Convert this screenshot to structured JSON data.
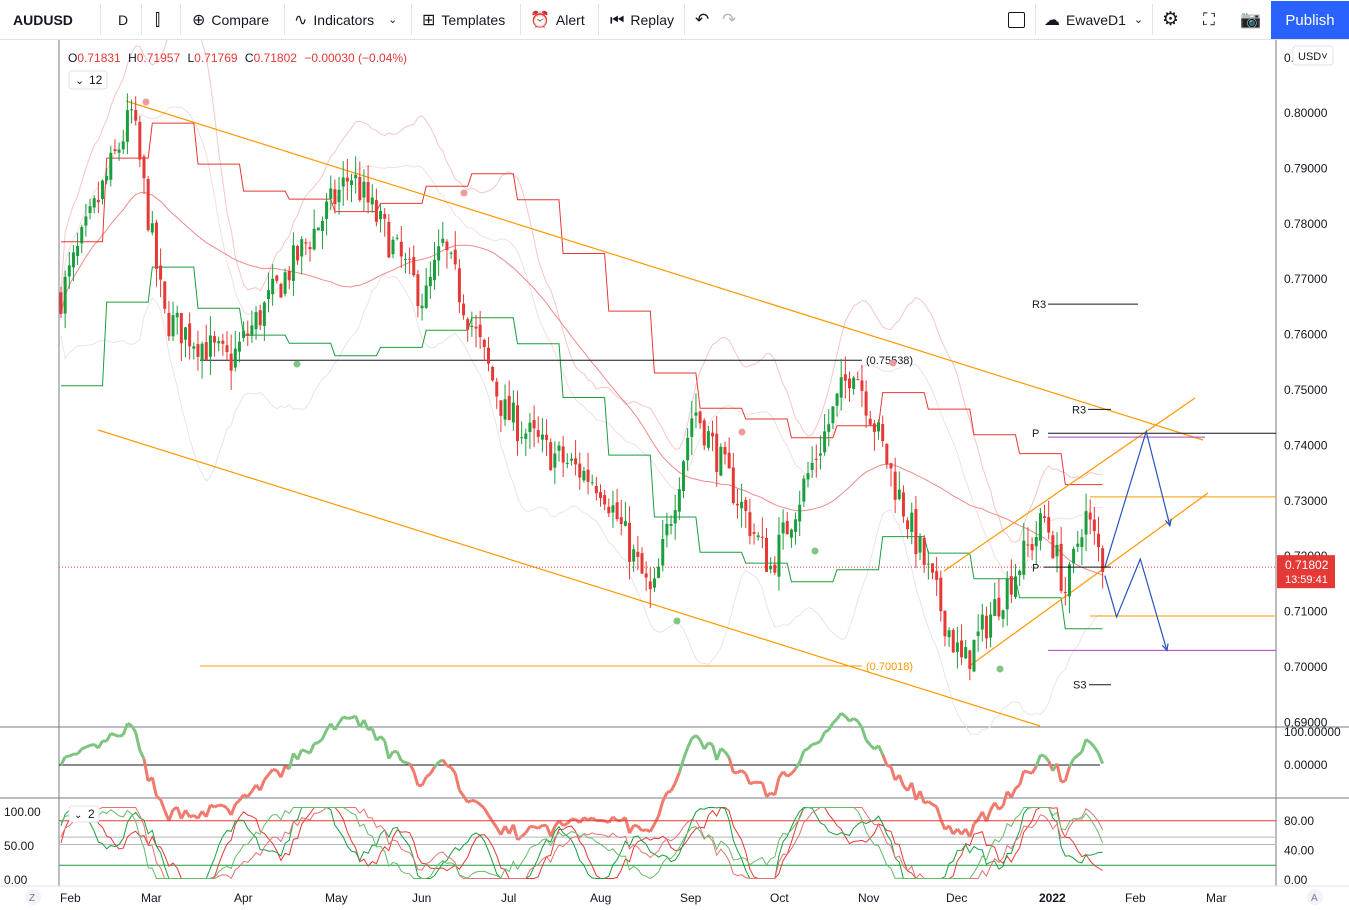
{
  "toolbar": {
    "symbol": "AUDUSD",
    "interval": "D",
    "compare": "Compare",
    "indicators": "Indicators",
    "templates": "Templates",
    "alert": "Alert",
    "replay": "Replay",
    "layout_name": "EwaveD1",
    "publish": "Publish"
  },
  "legend": {
    "ohlc": [
      {
        "k": "O",
        "v": "0.71831"
      },
      {
        "k": "H",
        "v": "0.71957"
      },
      {
        "k": "L",
        "v": "0.71769"
      },
      {
        "k": "C",
        "v": "0.71802"
      }
    ],
    "change": "−0.00030 (−0.04%)",
    "indicator_count": "12",
    "osc2_count": "2"
  },
  "price_axis": {
    "currency": "USD",
    "ticks": [
      "0.80000",
      "0.79000",
      "0.78000",
      "0.77000",
      "0.76000",
      "0.75000",
      "0.74000",
      "0.73000",
      "0.72000",
      "0.71000",
      "0.70000",
      "0.69000"
    ],
    "current_price": "0.71802",
    "countdown": "13:59:41",
    "top_tick": "0."
  },
  "osc1_axis": {
    "ticks": [
      "100.00000",
      "0.00000"
    ]
  },
  "osc2_axis": {
    "ticks_left": [
      "100.00",
      "50.00",
      "0.00"
    ],
    "ticks_right": [
      "80.00",
      "40.00",
      "0.00"
    ]
  },
  "time_axis": {
    "labels": [
      "Feb",
      "Mar",
      "Apr",
      "May",
      "Jun",
      "Jul",
      "Aug",
      "Sep",
      "Oct",
      "Nov",
      "Dec",
      "2022",
      "Feb",
      "Mar"
    ],
    "left_button": "Z",
    "right_button": "A"
  },
  "annotations": {
    "fib_high": "(0.75538)",
    "fib_low": "(0.70018)",
    "pivots": [
      {
        "label": "R3",
        "price": 0.7655
      },
      {
        "label": "R3",
        "price": 0.7465
      },
      {
        "label": "P",
        "price": 0.7422
      },
      {
        "label": "P",
        "price": 0.718
      },
      {
        "label": "S3",
        "price": 0.6968
      }
    ]
  },
  "colors": {
    "up": "#26a69a",
    "candle_up": "#1b9e3e",
    "candle_down": "#e53935",
    "channel": "#ff9800",
    "projection": "#2a52be",
    "accent": "#2962ff"
  },
  "chart_data": {
    "type": "candlestick",
    "symbol": "AUDUSD",
    "ylim": [
      0.69,
      0.81
    ],
    "x_range": [
      "2021-02-01",
      "2022-03-10"
    ],
    "current": {
      "open": 0.71831,
      "high": 0.71957,
      "low": 0.71769,
      "close": 0.71802
    },
    "swing_points": [
      {
        "date": "2021-02-01",
        "price": 0.767
      },
      {
        "date": "2021-02-25",
        "price": 0.8
      },
      {
        "date": "2021-03-08",
        "price": 0.763
      },
      {
        "date": "2021-03-30",
        "price": 0.755
      },
      {
        "date": "2021-05-10",
        "price": 0.789
      },
      {
        "date": "2021-06-04",
        "price": 0.766
      },
      {
        "date": "2021-06-10",
        "price": 0.776
      },
      {
        "date": "2021-07-01",
        "price": 0.746
      },
      {
        "date": "2021-07-15",
        "price": 0.739
      },
      {
        "date": "2021-08-03",
        "price": 0.733
      },
      {
        "date": "2021-08-20",
        "price": 0.712
      },
      {
        "date": "2021-09-03",
        "price": 0.747
      },
      {
        "date": "2021-09-29",
        "price": 0.718
      },
      {
        "date": "2021-10-27",
        "price": 0.755
      },
      {
        "date": "2021-11-10",
        "price": 0.733
      },
      {
        "date": "2021-12-03",
        "price": 0.7
      },
      {
        "date": "2021-12-14",
        "price": 0.711
      },
      {
        "date": "2021-12-31",
        "price": 0.727
      },
      {
        "date": "2022-01-07",
        "price": 0.713
      },
      {
        "date": "2022-01-13",
        "price": 0.728
      },
      {
        "date": "2022-01-20",
        "price": 0.718
      }
    ],
    "projection_path": [
      {
        "date": "2022-01-20",
        "price": 0.718
      },
      {
        "date": "2022-02-03",
        "price": 0.7425
      },
      {
        "date": "2022-02-11",
        "price": 0.7255
      }
    ],
    "projection_path_2": [
      {
        "date": "2022-01-20",
        "price": 0.7165
      },
      {
        "date": "2022-01-24",
        "price": 0.709
      },
      {
        "date": "2022-02-01",
        "price": 0.7195
      },
      {
        "date": "2022-02-10",
        "price": 0.703
      }
    ]
  }
}
